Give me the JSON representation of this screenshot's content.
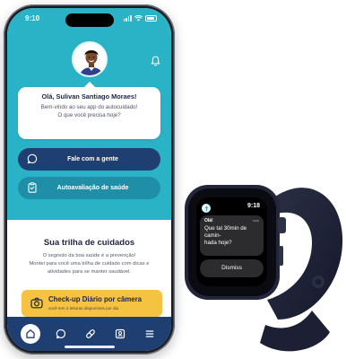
{
  "colors": {
    "teal": "#2ab3c7",
    "navy": "#1f3f73",
    "teal_dark": "#1f8fa8",
    "yellow": "#f5c242"
  },
  "phone": {
    "status_time": "9:10",
    "header": {
      "avatar_icon": "user-avatar",
      "bell_icon": "bell-icon"
    },
    "greeting": "Olá, Sulivan Santiago Moraes!",
    "welcome_line1": "Bem-vindo ao seu app do autocuidado!",
    "welcome_line2": "O que você precisa hoje?",
    "actions": [
      {
        "label": "Fale com a gente",
        "icon": "chat-bubble-icon"
      },
      {
        "label": "Autoavaliação de saúde",
        "icon": "clipboard-icon"
      }
    ],
    "trail": {
      "title": "Sua trilha de cuidados",
      "line1": "O segredo da boa saúde é a prevenção!",
      "line2": "Montei para você uma trilha de cuidado com dicas e",
      "line3": "atividades para se manter saudável."
    },
    "checkup": {
      "title": "Check-up Diário por câmera",
      "subtitle": "você tem 3 leituras disponíveis por dia",
      "icon": "camera-icon"
    },
    "tabbar": [
      {
        "icon": "home-icon",
        "active": true
      },
      {
        "icon": "chat-icon",
        "active": false
      },
      {
        "icon": "pill-icon",
        "active": false
      },
      {
        "icon": "id-card-icon",
        "active": false
      },
      {
        "icon": "menu-icon",
        "active": false
      }
    ]
  },
  "watch": {
    "time": "9:18",
    "sender": "Olá!",
    "received": "now",
    "message_line1": "Que tal 30min de camin-",
    "message_line2": "hada hoje?",
    "dismiss_label": "Dismiss"
  }
}
